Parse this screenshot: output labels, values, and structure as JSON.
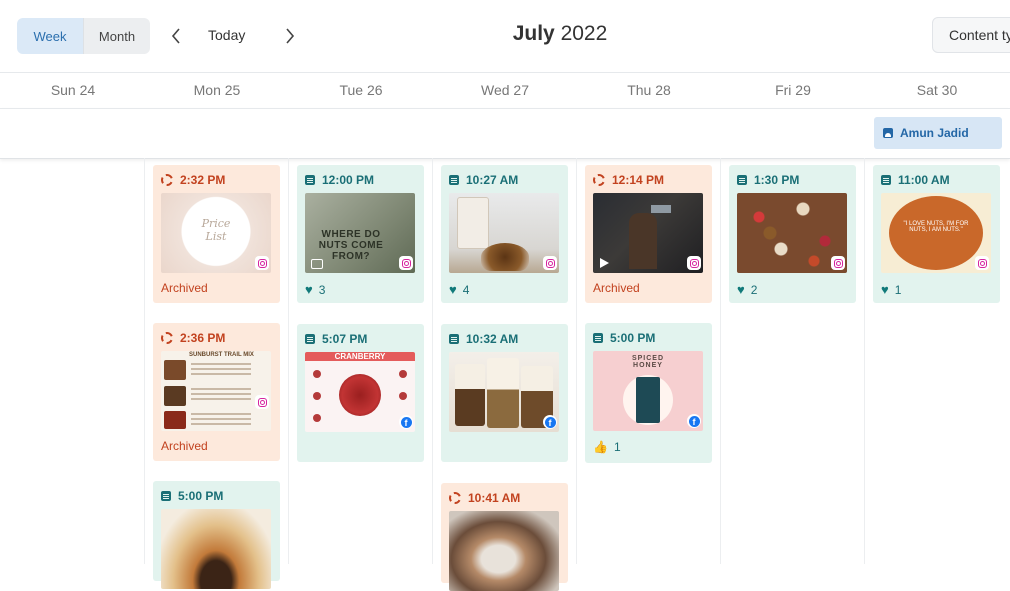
{
  "toolbar": {
    "view_week": "Week",
    "view_month": "Month",
    "today": "Today",
    "month_name": "July",
    "year": "2022",
    "content_type": "Content ty"
  },
  "days": [
    "Sun 24",
    "Mon 25",
    "Tue 26",
    "Wed 27",
    "Thu 28",
    "Fri 29",
    "Sat 30"
  ],
  "allday_event": {
    "label": "Amun Jadid"
  },
  "posts": {
    "mon_1": {
      "time": "2:32 PM",
      "status": "Archived",
      "network": "instagram",
      "thumb_text": "Price List"
    },
    "mon_2": {
      "time": "2:36 PM",
      "status": "Archived",
      "network": "instagram",
      "thumb_text": "SUNBURST TRAIL MIX"
    },
    "mon_3": {
      "time": "5:00 PM",
      "network": "instagram"
    },
    "tue_1": {
      "time": "12:00 PM",
      "likes": "3",
      "network": "instagram",
      "thumb_text": "WHERE DO NUTS COME FROM?"
    },
    "tue_2": {
      "time": "5:07 PM",
      "network": "facebook",
      "thumb_text": "CRANBERRY"
    },
    "wed_1": {
      "time": "10:27 AM",
      "likes": "4",
      "network": "instagram"
    },
    "wed_2": {
      "time": "10:32 AM",
      "network": "facebook"
    },
    "wed_3": {
      "time": "10:41 AM",
      "network": "instagram"
    },
    "thu_1": {
      "time": "12:14 PM",
      "status": "Archived",
      "network": "instagram"
    },
    "thu_2": {
      "time": "5:00 PM",
      "thumbs_up": "1",
      "network": "facebook",
      "thumb_text": "SPICED HONEY"
    },
    "fri_1": {
      "time": "1:30 PM",
      "likes": "2",
      "network": "instagram"
    },
    "sat_1": {
      "time": "11:00 AM",
      "likes": "1",
      "network": "instagram",
      "thumb_text": "\"I LOVE NUTS, I'M FOR NUTS, I AM NUTS.\""
    }
  }
}
